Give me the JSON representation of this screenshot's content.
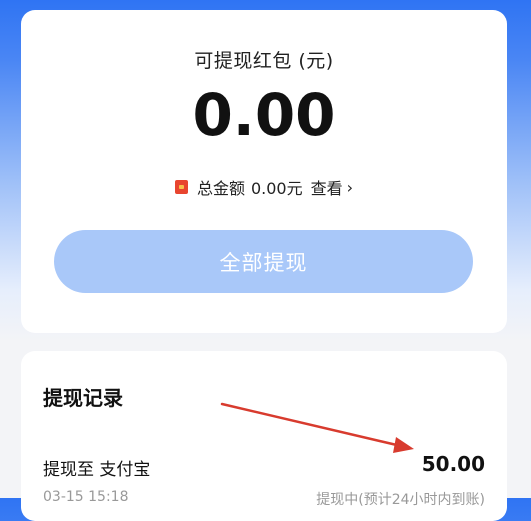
{
  "balance": {
    "label": "可提现红包 (元)",
    "amount": "0.00",
    "total_label": "总金额",
    "total_value": "0.00元",
    "view_label": "查看",
    "chevron": "›",
    "icon": "red-packet-icon"
  },
  "actions": {
    "withdraw_all_label": "全部提现"
  },
  "records": {
    "title": "提现记录",
    "items": [
      {
        "label": "提现至 支付宝",
        "amount": "50.00",
        "time": "03-15 15:18",
        "status": "提现中(预计24小时内到账)"
      }
    ]
  },
  "colors": {
    "primary_blue": "#2f74f3",
    "button_disabled": "#a9c8f9",
    "annotation_arrow": "#d83b2e",
    "red_packet": "#e8452f"
  }
}
